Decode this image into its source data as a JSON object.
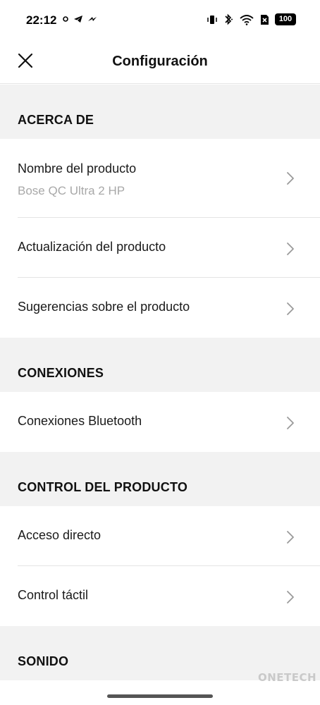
{
  "status_bar": {
    "time": "22:12",
    "left_icons": [
      "notification-dot-icon",
      "telegram-icon",
      "app-icon"
    ],
    "right_icons": [
      "vibrate-icon",
      "bluetooth-icon",
      "wifi-icon",
      "sim-icon"
    ],
    "battery": "100"
  },
  "header": {
    "title": "Configuración",
    "close_icon": "close-icon"
  },
  "sections": [
    {
      "title": "ACERCA DE",
      "items": [
        {
          "label": "Nombre del producto",
          "value": "Bose QC Ultra 2 HP"
        },
        {
          "label": "Actualización del producto"
        },
        {
          "label": "Sugerencias sobre el producto"
        }
      ]
    },
    {
      "title": "CONEXIONES",
      "items": [
        {
          "label": "Conexiones Bluetooth"
        }
      ]
    },
    {
      "title": "CONTROL DEL PRODUCTO",
      "items": [
        {
          "label": "Acceso directo"
        },
        {
          "label": "Control táctil"
        }
      ]
    },
    {
      "title": "SONIDO",
      "items": []
    }
  ],
  "watermark": "ONETECH",
  "colors": {
    "section_bg": "#f2f2f2",
    "divider": "#e4e4e4",
    "secondary_text": "#a8a8a8",
    "chevron": "#9a9a9a"
  }
}
